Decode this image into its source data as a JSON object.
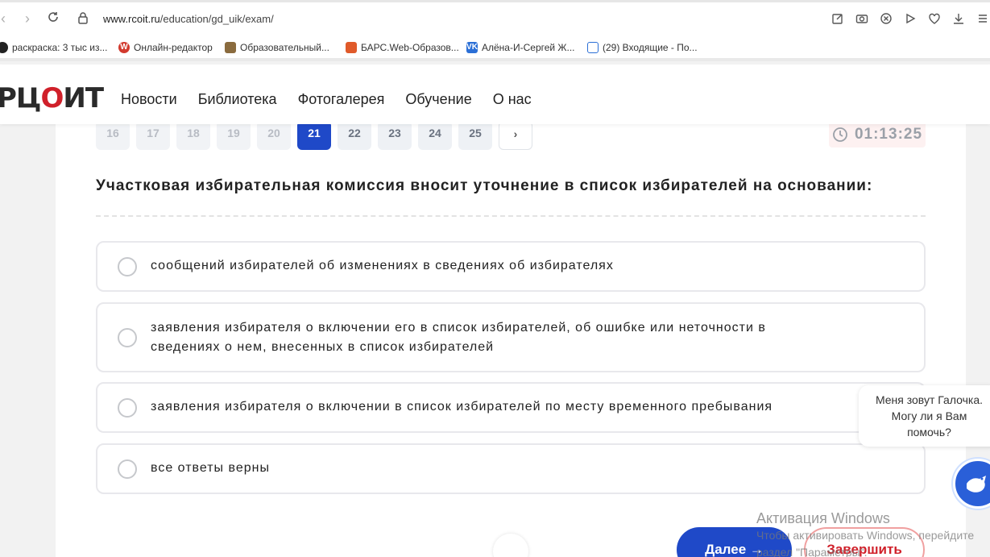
{
  "browser": {
    "url_host": "www.rcoit.ru",
    "url_path": "/education/gd_uik/exam/",
    "bookmarks": [
      {
        "label": "раскраска: 3 тыс из...",
        "icon": "bookmark-favicon",
        "color": "#222222"
      },
      {
        "label": "Онлайн-редактор",
        "icon": "w-favicon",
        "color": "#d23a2e"
      },
      {
        "label": "Образовательный...",
        "icon": "image-favicon",
        "color": "#8a6b3e"
      },
      {
        "label": "БАРС.Web-Образов...",
        "icon": "bars-favicon",
        "color": "#e05a2a"
      },
      {
        "label": "Алёна-И-Сергей Ж...",
        "icon": "vk-favicon",
        "color": "#2b6fd6"
      },
      {
        "label": "(29) Входящие - По...",
        "icon": "mail-favicon",
        "color": "#2b6fd6"
      }
    ]
  },
  "site": {
    "logo": {
      "part1": "РЦ",
      "check": "О",
      "part2": "ИТ"
    },
    "menu": [
      "Новости",
      "Библиотека",
      "Фотогалерея",
      "Обучение",
      "О нас"
    ]
  },
  "exam": {
    "pages": [
      "16",
      "17",
      "18",
      "19",
      "20",
      "21",
      "22",
      "23",
      "24",
      "25"
    ],
    "active_page": "21",
    "next_label": "›",
    "timer": "01:13:25",
    "question": "Участковая избирательная комиссия вносит уточнение в список избирателей на основании:",
    "options": [
      "сообщений избирателей об изменениях в сведениях об избирателях",
      "заявления избирателя о включении его в список избирателей, об ошибке или неточности в",
      "сведениях о нем, внесенных в список избирателей",
      "заявления избирателя о включении в список избирателей по месту временного пребывания",
      "все ответы верны"
    ],
    "next_button": "Далее →",
    "finish_button": "Завершить"
  },
  "chat": {
    "line1": "Меня зовут Галочка.",
    "line2": "Могу ли я Вам",
    "line3": "помочь?"
  },
  "watermark": {
    "title": "Активация Windows",
    "sub": "Чтобы активировать Windows, перейдите",
    "sub2": "раздел \"Параметры\"."
  }
}
